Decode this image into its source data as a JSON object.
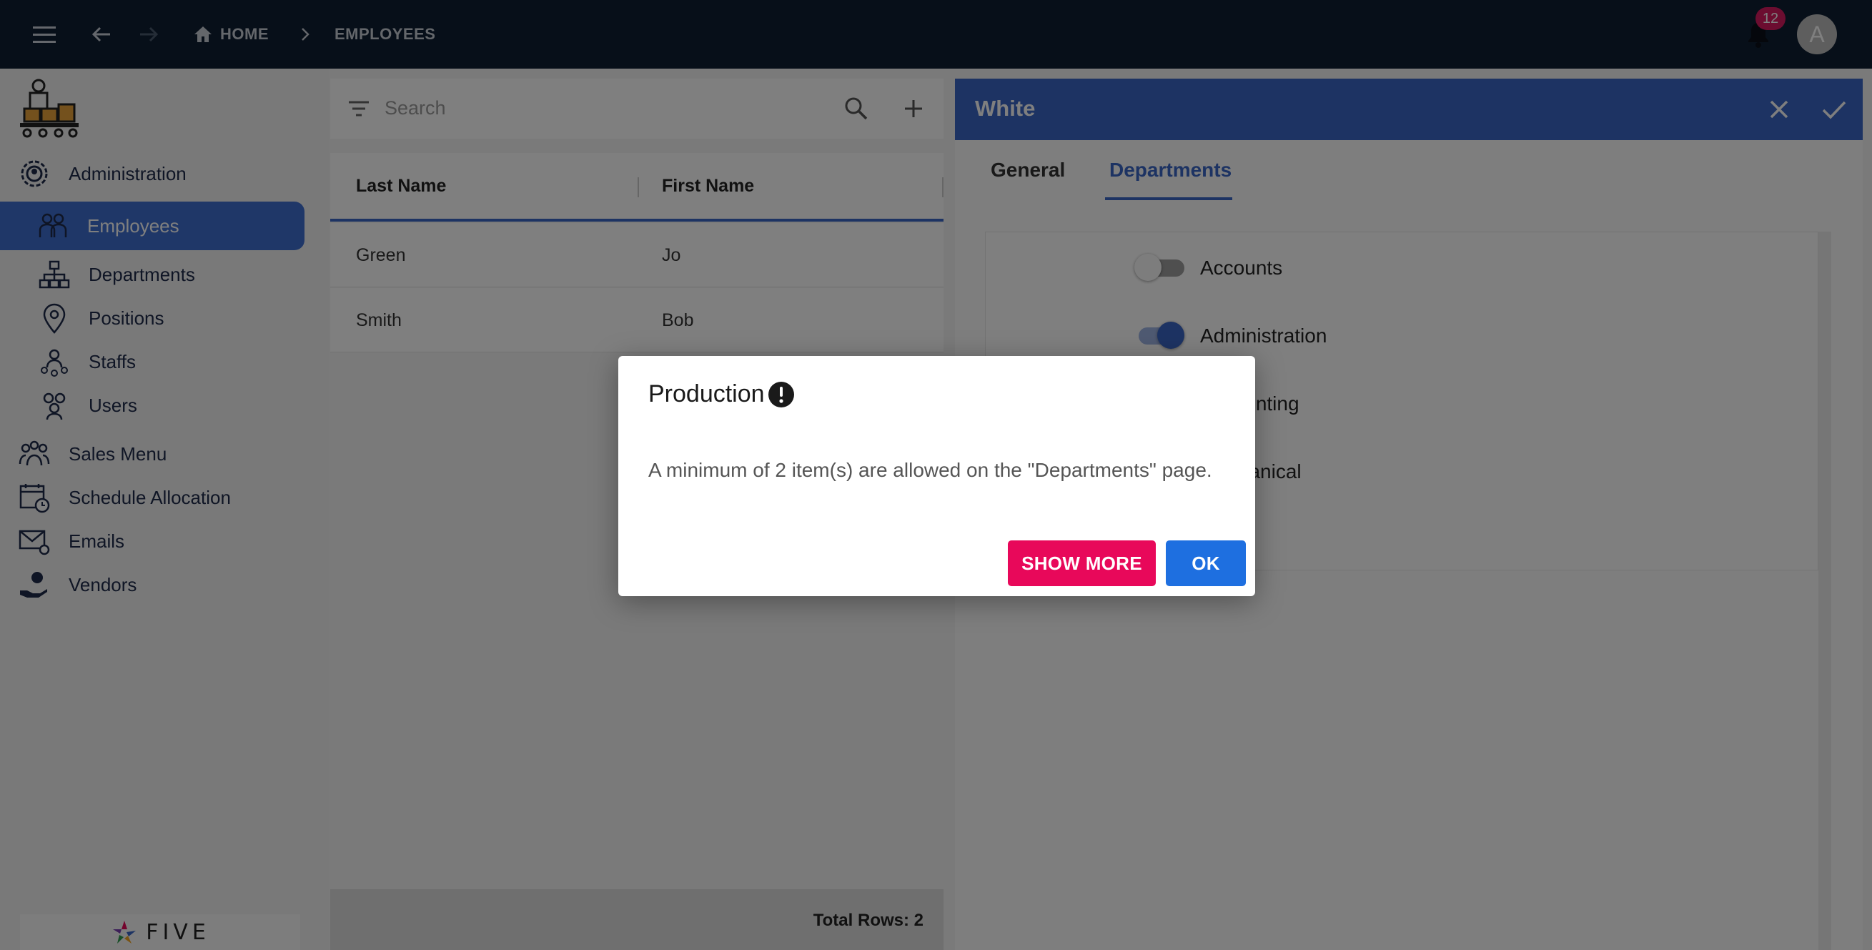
{
  "topbar": {
    "breadcrumb_home": "HOME",
    "breadcrumb_current": "EMPLOYEES",
    "notification_count": "12",
    "avatar_initial": "A"
  },
  "sidebar": {
    "items": [
      {
        "label": "Administration",
        "icon": "admin-gear-icon"
      },
      {
        "label": "Employees",
        "icon": "employees-icon",
        "active": true
      },
      {
        "label": "Departments",
        "icon": "hierarchy-icon"
      },
      {
        "label": "Positions",
        "icon": "location-pin-icon"
      },
      {
        "label": "Staffs",
        "icon": "staff-icon"
      },
      {
        "label": "Users",
        "icon": "users-icon"
      },
      {
        "label": "Sales Menu",
        "icon": "sales-group-icon"
      },
      {
        "label": "Schedule Allocation",
        "icon": "calendar-clock-icon"
      },
      {
        "label": "Emails",
        "icon": "email-icon"
      },
      {
        "label": "Vendors",
        "icon": "vendor-hand-icon"
      }
    ],
    "footer_brand": "FIVE"
  },
  "list": {
    "search_placeholder": "Search",
    "columns": [
      "Last Name",
      "First Name"
    ],
    "rows": [
      {
        "last": "Green",
        "first": "Jo"
      },
      {
        "last": "Smith",
        "first": "Bob"
      }
    ],
    "total_rows": "Total Rows: 2"
  },
  "form": {
    "title": "White",
    "tabs": [
      "General",
      "Departments"
    ],
    "active_tab": "Departments",
    "departments": [
      {
        "label": "Accounts",
        "on": false
      },
      {
        "label": "Administration",
        "on": true
      },
      {
        "label": "Accounting",
        "on": false
      },
      {
        "label": "Mechanical",
        "on": false
      }
    ]
  },
  "dialog": {
    "title": "Production",
    "message": "A minimum of 2 item(s) are allowed on the \"Departments\" page.",
    "show_more_label": "SHOW MORE",
    "ok_label": "OK"
  },
  "colors": {
    "topbar": "#0f1e33",
    "accent": "#3a67c7",
    "show_more": "#e8085a",
    "ok": "#1e6fe0",
    "badge": "#d81b60"
  }
}
